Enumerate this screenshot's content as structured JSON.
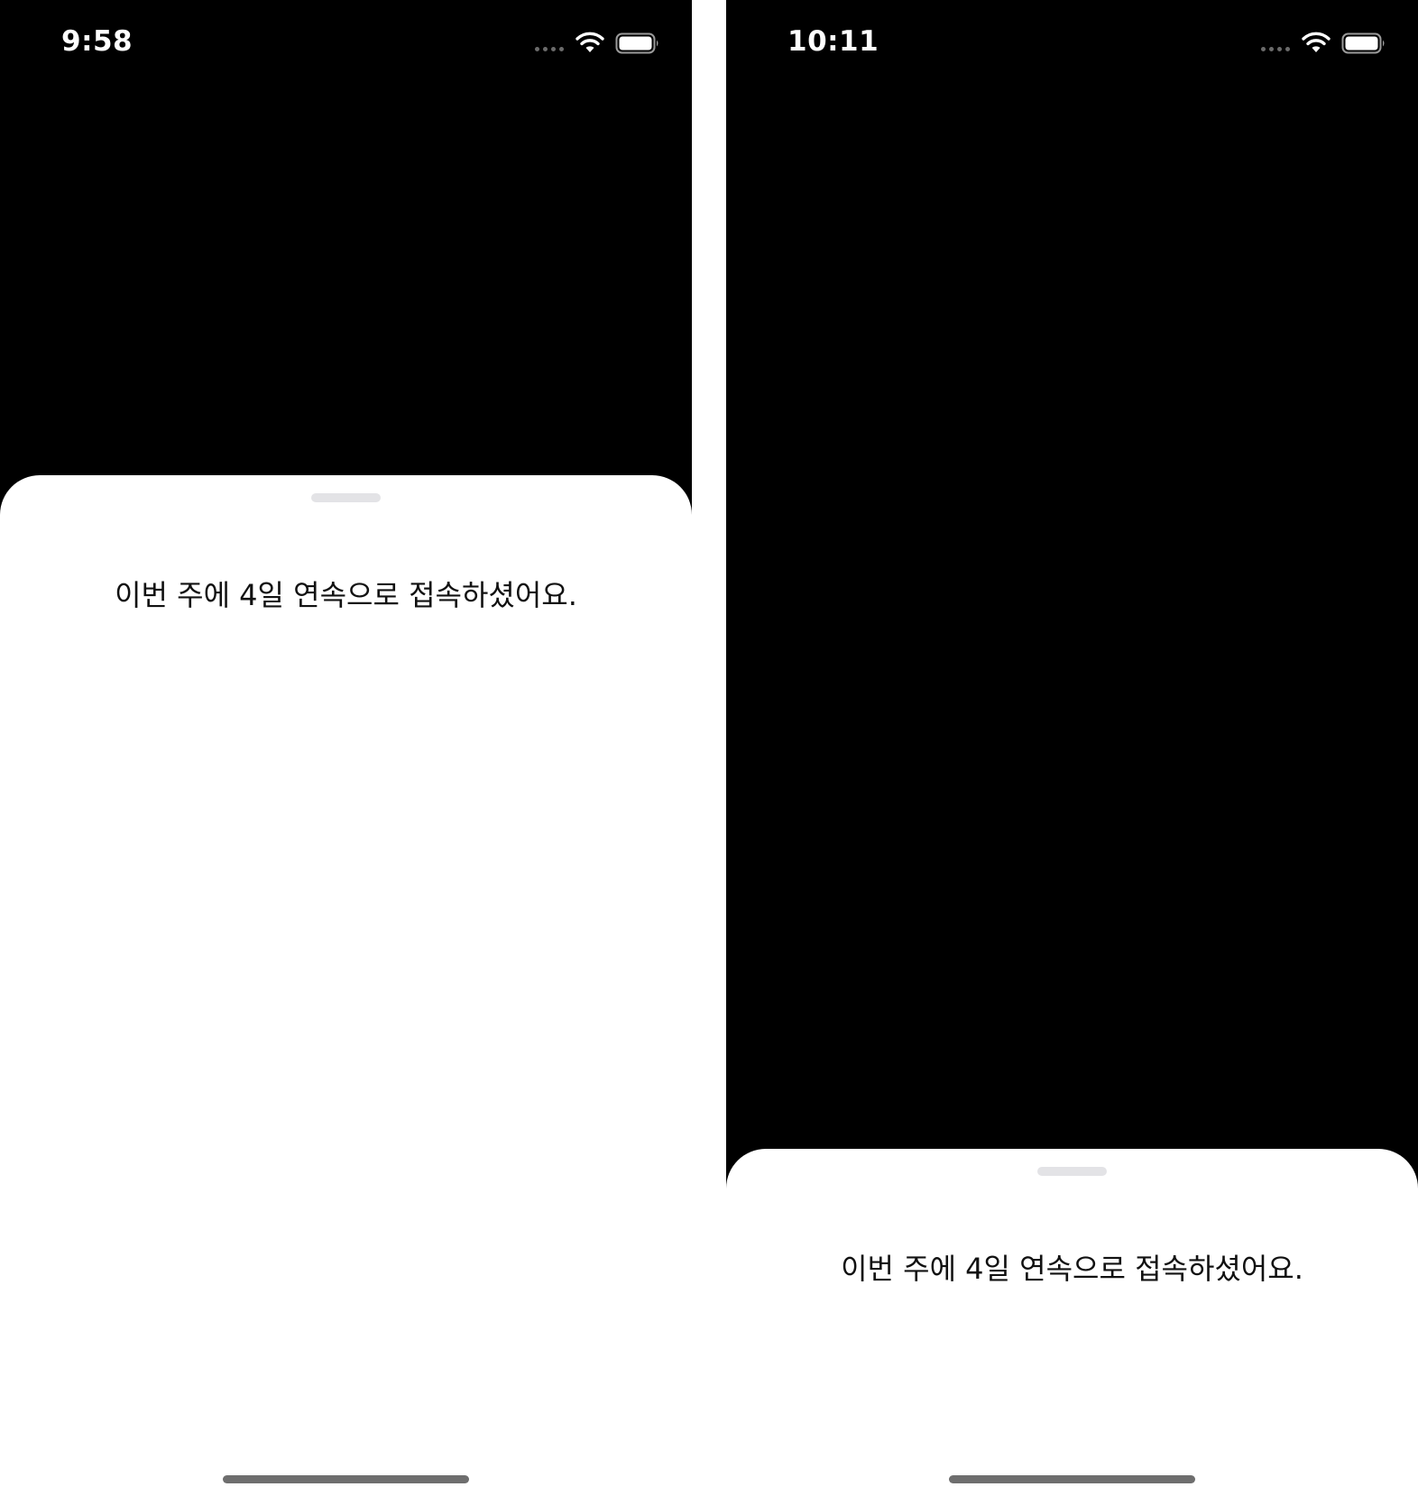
{
  "screens": [
    {
      "status_bar": {
        "time": "9:58"
      },
      "sheet": {
        "message": "이번 주에 4일 연속으로 접속하셨어요."
      }
    },
    {
      "status_bar": {
        "time": "10:11"
      },
      "sheet": {
        "message": "이번 주에 4일 연속으로 접속하셨어요."
      }
    }
  ],
  "icons": {
    "signal": "cellular-signal-icon",
    "wifi": "wifi-icon",
    "battery": "battery-icon"
  },
  "colors": {
    "background": "#000000",
    "sheet": "#ffffff",
    "grabber": "#e3e3e6",
    "home_indicator": "#6e6e6e",
    "status_text": "#ffffff"
  }
}
